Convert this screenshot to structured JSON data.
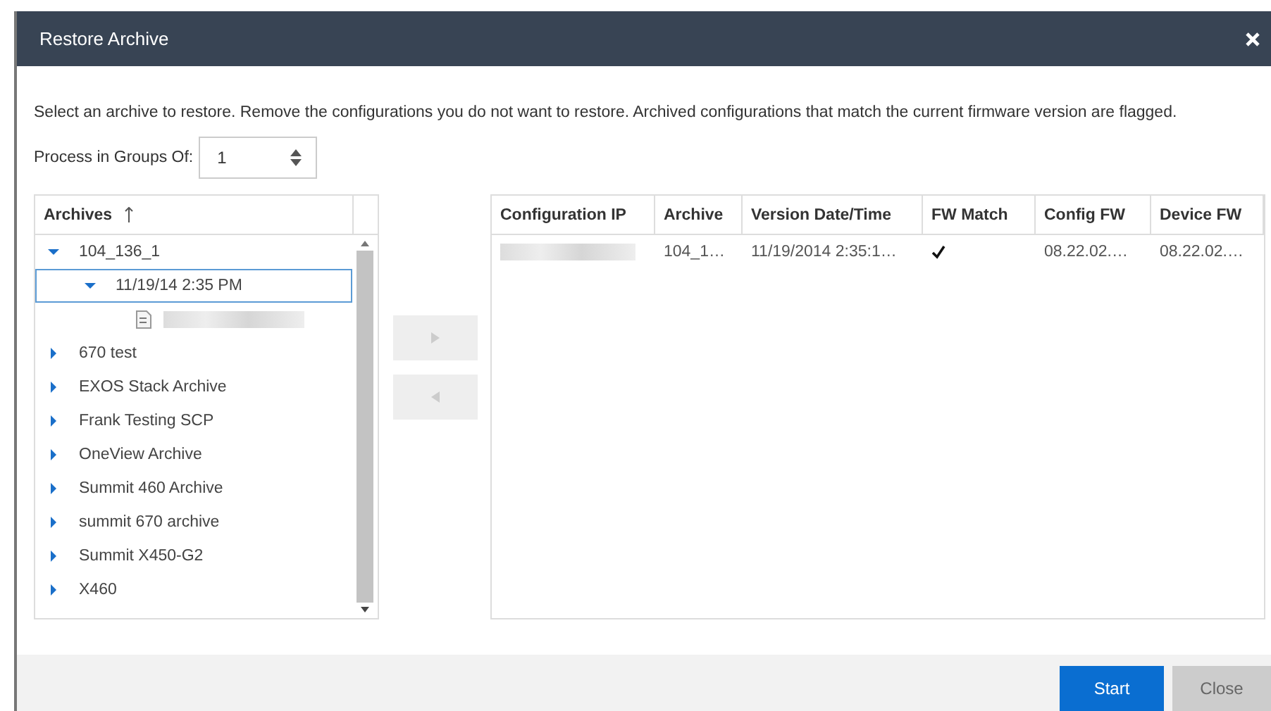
{
  "window": {
    "title": "Restore Archive"
  },
  "instructions": "Select an archive to restore. Remove the configurations you do not want to restore. Archived configurations that match the current firmware version are flagged.",
  "group_size": {
    "label": "Process in Groups Of:",
    "value": "1"
  },
  "archives": {
    "heading": "Archives",
    "items": [
      {
        "kind": "folder",
        "label": "104_136_1",
        "expanded": true,
        "selected": false,
        "children": [
          {
            "kind": "folder",
            "label": "11/19/14 2:35 PM",
            "expanded": true,
            "selected": true,
            "children": [
              {
                "kind": "config-file"
              }
            ]
          }
        ]
      },
      {
        "kind": "folder",
        "label": "670 test",
        "expanded": false,
        "selected": false
      },
      {
        "kind": "folder",
        "label": "EXOS Stack Archive",
        "expanded": false,
        "selected": false
      },
      {
        "kind": "folder",
        "label": "Frank Testing SCP",
        "expanded": false,
        "selected": false
      },
      {
        "kind": "folder",
        "label": "OneView Archive",
        "expanded": false,
        "selected": false
      },
      {
        "kind": "folder",
        "label": "Summit 460 Archive",
        "expanded": false,
        "selected": false
      },
      {
        "kind": "folder",
        "label": "summit 670 archive",
        "expanded": false,
        "selected": false
      },
      {
        "kind": "folder",
        "label": "Summit X450-G2",
        "expanded": false,
        "selected": false
      },
      {
        "kind": "folder",
        "label": "X460",
        "expanded": false,
        "selected": false
      }
    ]
  },
  "move_buttons": [
    {
      "kind": "add",
      "disabled": true
    },
    {
      "kind": "remove",
      "disabled": true
    }
  ],
  "table": {
    "columns": [
      "Configuration IP",
      "Archive",
      "Version Date/Time",
      "FW Match",
      "Config FW",
      "Device FW"
    ],
    "rows": [
      {
        "archive": "104_1…",
        "version_date_time": "11/19/2014 2:35:1…",
        "fw_match": true,
        "config_fw": "08.22.02.…",
        "device_fw": "08.22.02.…"
      }
    ]
  },
  "buttons": [
    {
      "label": "Start",
      "kind": "primary"
    },
    {
      "label": "Close",
      "kind": "secondary"
    }
  ]
}
